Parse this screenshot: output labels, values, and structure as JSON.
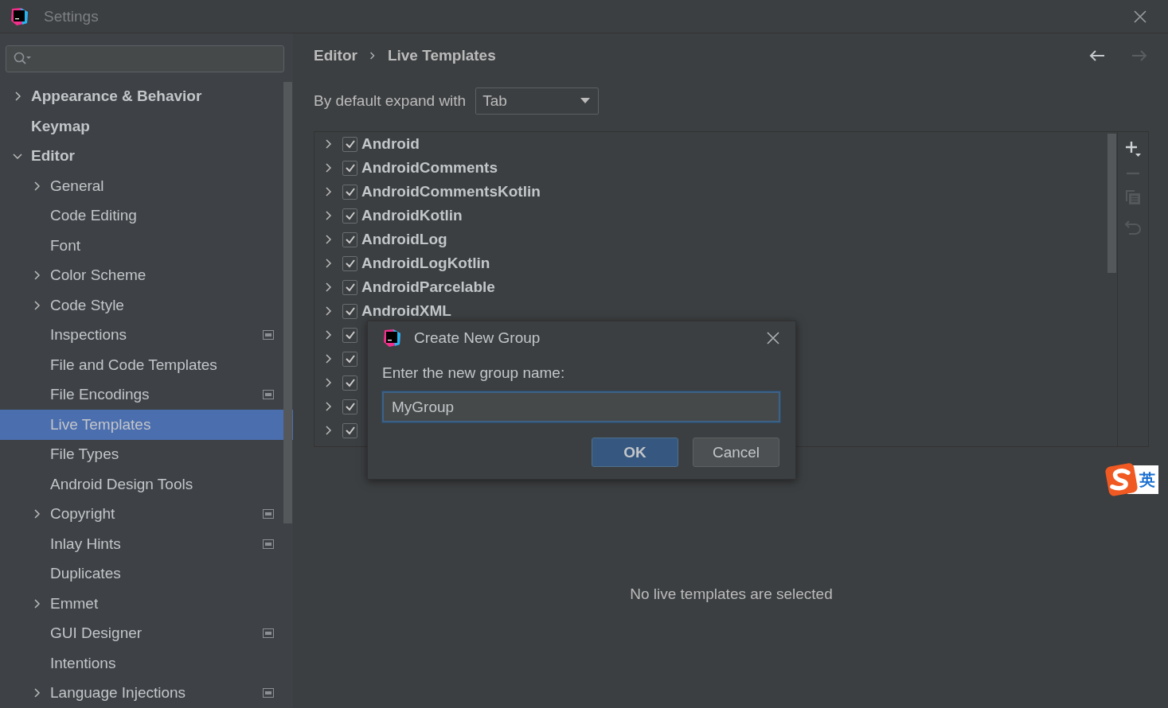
{
  "window": {
    "title": "Settings"
  },
  "sidebar": {
    "items": [
      {
        "label": "Appearance & Behavior",
        "expanded": false,
        "selected": false
      },
      {
        "label": "Keymap",
        "selected": false
      },
      {
        "label": "Editor",
        "expanded": true,
        "selected": false,
        "children": [
          {
            "label": "General",
            "expanded": false,
            "selected": false
          },
          {
            "label": "Code Editing",
            "selected": false
          },
          {
            "label": "Font",
            "selected": false
          },
          {
            "label": "Color Scheme",
            "expanded": false,
            "selected": false
          },
          {
            "label": "Code Style",
            "expanded": false,
            "selected": false
          },
          {
            "label": "Inspections",
            "selected": false,
            "project_scope": true
          },
          {
            "label": "File and Code Templates",
            "selected": false
          },
          {
            "label": "File Encodings",
            "selected": false,
            "project_scope": true
          },
          {
            "label": "Live Templates",
            "selected": true
          },
          {
            "label": "File Types",
            "selected": false
          },
          {
            "label": "Android Design Tools",
            "selected": false
          },
          {
            "label": "Copyright",
            "expanded": false,
            "selected": false,
            "project_scope": true
          },
          {
            "label": "Inlay Hints",
            "selected": false,
            "project_scope": true
          },
          {
            "label": "Duplicates",
            "selected": false
          },
          {
            "label": "Emmet",
            "expanded": false,
            "selected": false
          },
          {
            "label": "GUI Designer",
            "selected": false,
            "project_scope": true
          },
          {
            "label": "Intentions",
            "selected": false
          },
          {
            "label": "Language Injections",
            "expanded": false,
            "selected": false,
            "project_scope": true
          }
        ]
      }
    ]
  },
  "breadcrumb": [
    "Editor",
    "Live Templates"
  ],
  "expand_with": {
    "label": "By default expand with",
    "value": "Tab"
  },
  "templates": [
    {
      "label": "Android",
      "expanded": false,
      "checked": true
    },
    {
      "label": "AndroidComments",
      "expanded": false,
      "checked": true
    },
    {
      "label": "AndroidCommentsKotlin",
      "expanded": false,
      "checked": true
    },
    {
      "label": "AndroidKotlin",
      "expanded": false,
      "checked": true
    },
    {
      "label": "AndroidLog",
      "expanded": false,
      "checked": true
    },
    {
      "label": "AndroidLogKotlin",
      "expanded": false,
      "checked": true
    },
    {
      "label": "AndroidParcelable",
      "expanded": false,
      "checked": true
    },
    {
      "label": "AndroidXML",
      "expanded": false,
      "checked": true
    },
    {
      "expanded": false,
      "checked": true
    },
    {
      "expanded": false,
      "checked": true
    },
    {
      "expanded": false,
      "checked": true
    },
    {
      "expanded": false,
      "checked": true
    },
    {
      "expanded": false,
      "checked": true
    }
  ],
  "empty_message": "No live templates are selected",
  "dialog": {
    "title": "Create New Group",
    "prompt": "Enter the new group name:",
    "value": "MyGroup",
    "buttons": [
      {
        "label": "OK",
        "kind": "primary"
      },
      {
        "label": "Cancel",
        "kind": "secondary"
      }
    ]
  },
  "ime_indicator": {
    "label": "英"
  }
}
